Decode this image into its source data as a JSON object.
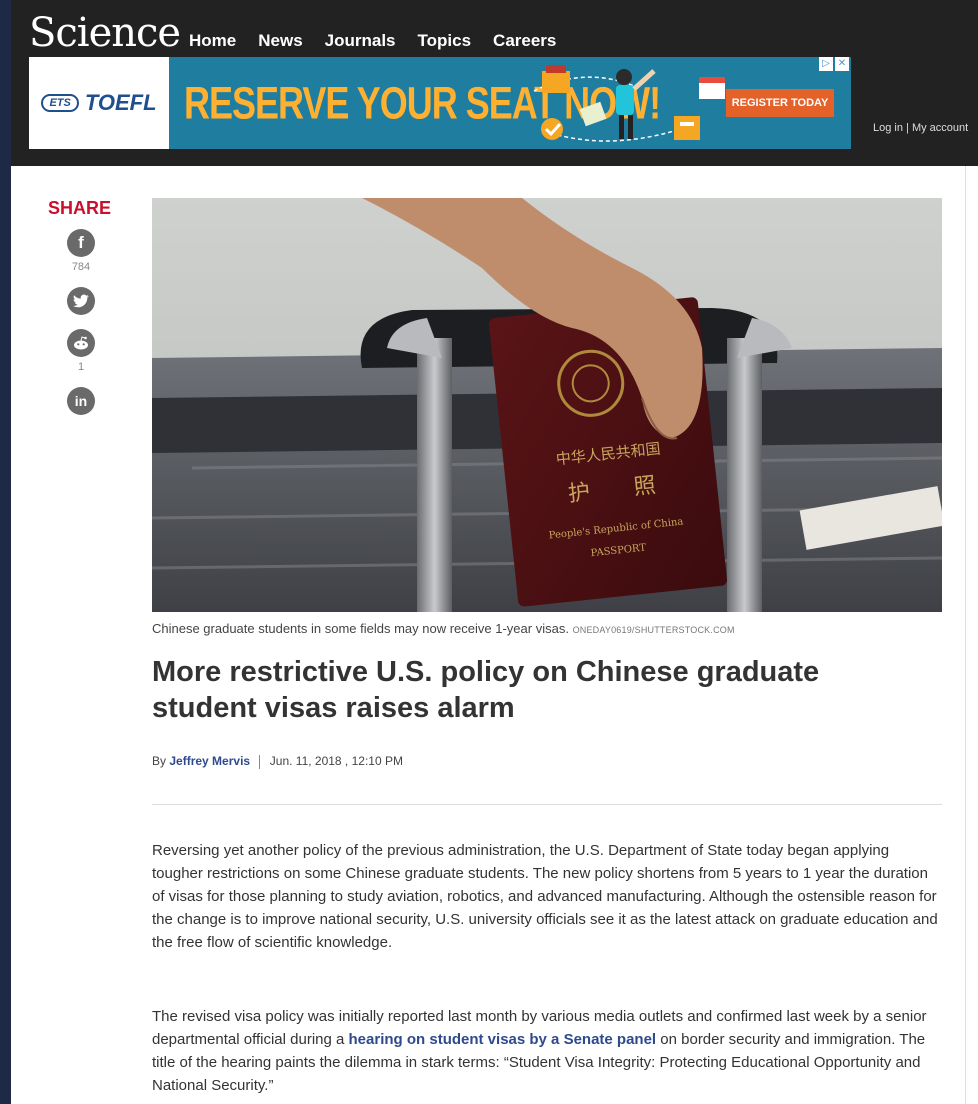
{
  "header": {
    "logo": "Science",
    "nav": [
      "Home",
      "News",
      "Journals",
      "Topics",
      "Careers"
    ],
    "account": "Log in | My account"
  },
  "ad": {
    "ets": "ETS",
    "brand": "TOEFL",
    "headline": "RESERVE YOUR SEAT NOW!",
    "cta": "REGISTER TODAY"
  },
  "share": {
    "title": "SHARE",
    "facebook_count": "784",
    "reddit_count": "1"
  },
  "article": {
    "caption": "Chinese graduate students in some fields may now receive 1-year visas.",
    "credit": "ONEDAY0619/SHUTTERSTOCK.COM",
    "title": "More restrictive U.S. policy on Chinese graduate student visas raises alarm",
    "byline_prefix": "By",
    "author": "Jeffrey Mervis",
    "date": "Jun. 11, 2018 , 12:10 PM",
    "para1": "Reversing yet another policy of the previous administration, the U.S. Department of State today began applying tougher restrictions on some Chinese graduate students. The new policy shortens from 5 years to 1 year the duration of visas for those planning to study aviation, robotics, and advanced manufacturing. Although the ostensible reason for the change is to improve national security, U.S. university officials see it as the latest attack on graduate education and the free flow of scientific knowledge.",
    "para2_before": "The revised visa policy was initially reported last month by various media outlets and confirmed last week by a senior departmental official during a ",
    "para2_link": "hearing on student visas by a Senate panel",
    "para2_after": " on border security and immigration. The title of the hearing paints the dilemma in stark terms: “Student Visa Integrity: Protecting Educational Opportunity and National Security.”"
  },
  "passport_text": {
    "line1": "中华人民共和国",
    "line2": "护　　照",
    "line3": "People's Republic of China",
    "line4": "PASSPORT"
  }
}
